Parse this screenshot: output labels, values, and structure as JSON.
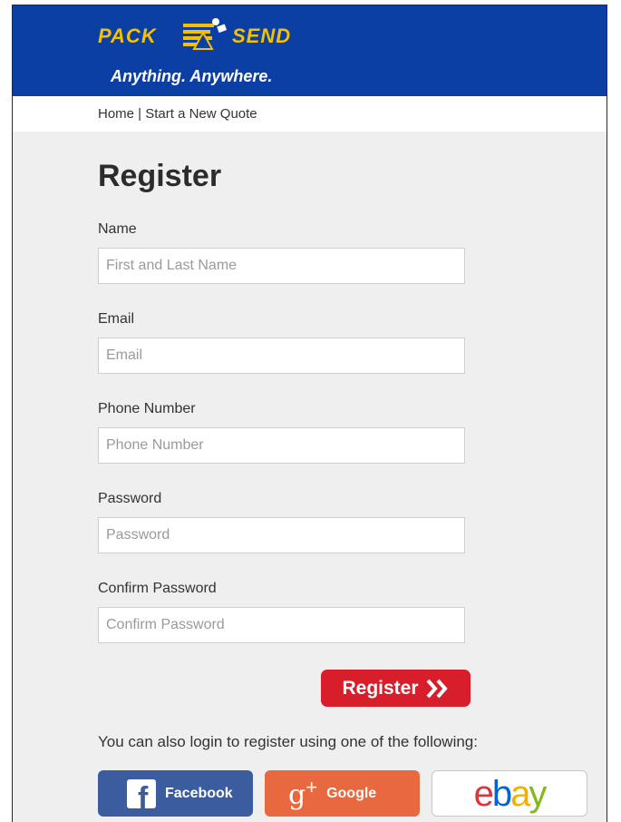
{
  "brand": {
    "word_left": "PACK",
    "word_right": "SEND",
    "tagline": "Anything. Anywhere.",
    "colors": {
      "header_bg": "#0b3fa4",
      "logo_yellow": "#f6c000"
    }
  },
  "breadcrumb": {
    "home": "Home",
    "separator": " | ",
    "current": "Start a New Quote"
  },
  "form": {
    "title": "Register",
    "fields": [
      {
        "label": "Name",
        "placeholder": "First and Last Name",
        "value": ""
      },
      {
        "label": "Email",
        "placeholder": "Email",
        "value": ""
      },
      {
        "label": "Phone Number",
        "placeholder": "Phone Number",
        "value": ""
      },
      {
        "label": "Password",
        "placeholder": "Password",
        "value": ""
      },
      {
        "label": "Confirm Password",
        "placeholder": "Confirm Password",
        "value": ""
      }
    ],
    "submit_label": "Register",
    "submit_icon": "double-chevron-right-icon",
    "submit_color": "#d81e2a"
  },
  "social": {
    "intro": "You can also login to register using one of the following:",
    "facebook_label": "Facebook",
    "google_label": "Google",
    "google_mark": "g",
    "google_plus": "+",
    "ebay_letters": [
      "e",
      "b",
      "a",
      "y"
    ],
    "colors": {
      "facebook": "#3b5da0",
      "google": "#e8683f"
    }
  }
}
